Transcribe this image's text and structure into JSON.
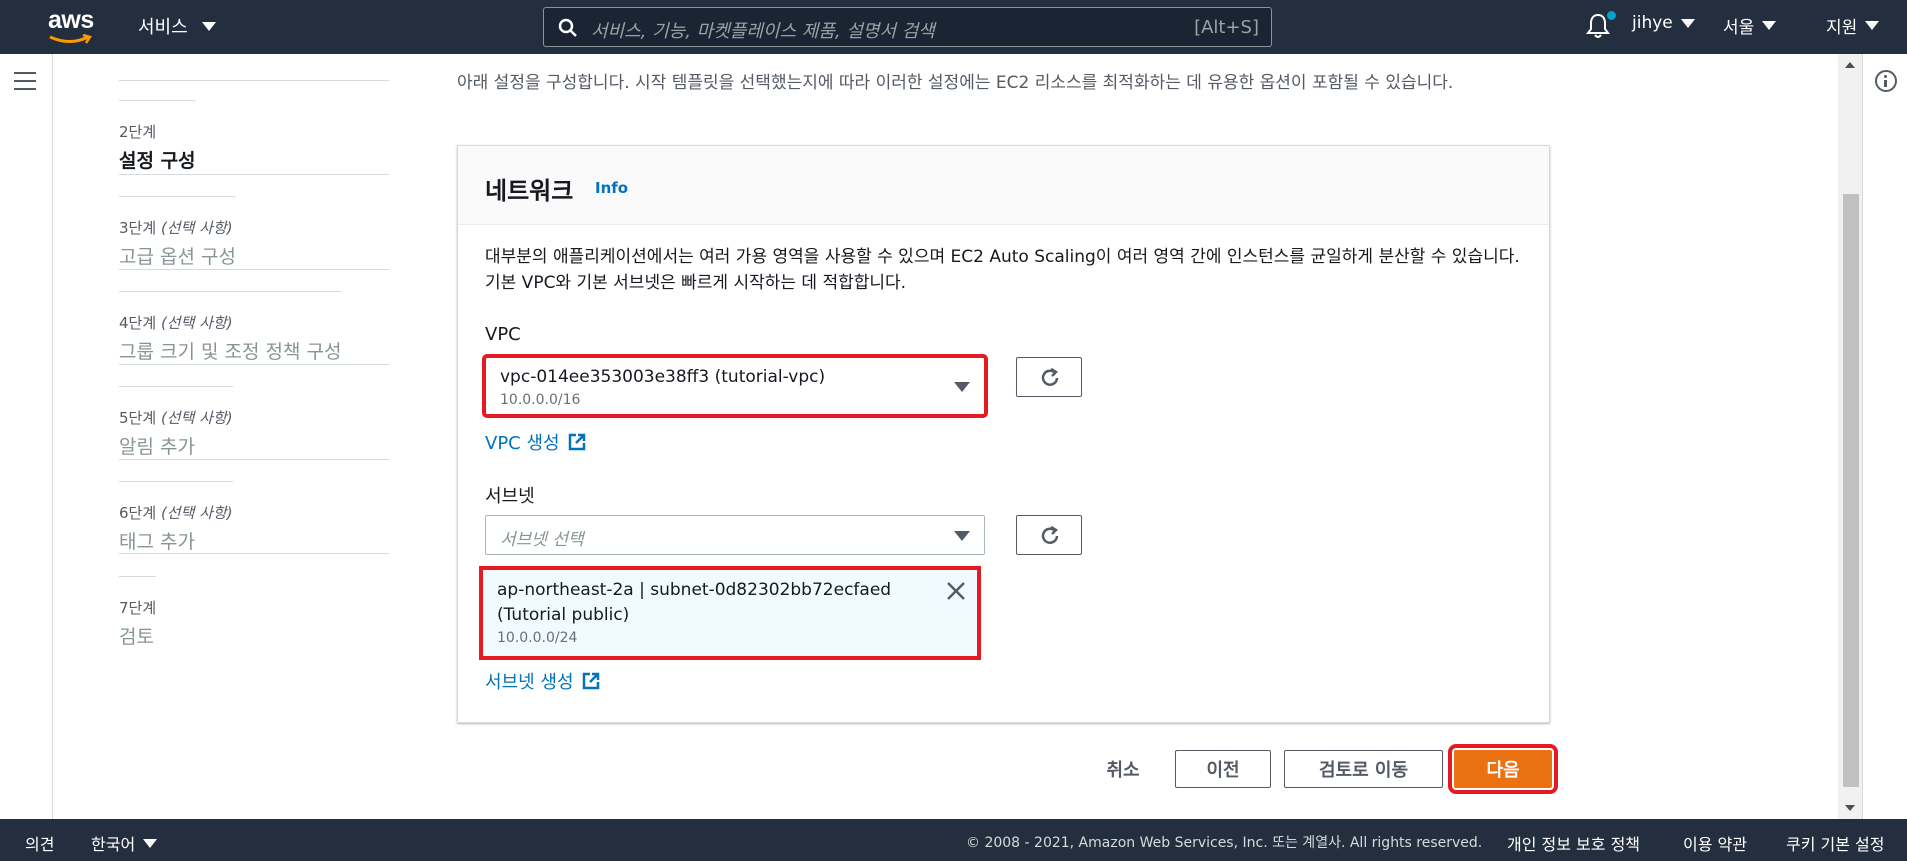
{
  "nav": {
    "logo": "aws",
    "services": "서비스",
    "search_placeholder": "서비스, 기능, 마켓플레이스 제품, 설명서 검색",
    "search_shortcut": "[Alt+S]",
    "user": "jihye",
    "region": "서울",
    "support": "지원"
  },
  "steps": [
    {
      "num": "2단계",
      "optional": "",
      "title": "설정 구성"
    },
    {
      "num": "3단계",
      "optional": "(선택 사항)",
      "title": "고급 옵션 구성"
    },
    {
      "num": "4단계",
      "optional": "(선택 사항)",
      "title": "그룹 크기 및 조정 정책 구성"
    },
    {
      "num": "5단계",
      "optional": "(선택 사항)",
      "title": "알림 추가"
    },
    {
      "num": "6단계",
      "optional": "(선택 사항)",
      "title": "태그 추가"
    },
    {
      "num": "7단계",
      "optional": "",
      "title": "검토"
    }
  ],
  "intro": "아래 설정을 구성합니다. 시작 템플릿을 선택했는지에 따라 이러한 설정에는 EC2 리소스를 최적화하는 데 유용한 옵션이 포함될 수 있습니다.",
  "network": {
    "title": "네트워크",
    "info": "Info",
    "desc": "대부분의 애플리케이션에서는 여러 가용 영역을 사용할 수 있으며 EC2 Auto Scaling이 여러 영역 간에 인스턴스를 균일하게 분산할 수 있습니다. 기본 VPC와 기본 서브넷은 빠르게 시작하는 데 적합합니다.",
    "vpc_label": "VPC",
    "vpc_value": "vpc-014ee353003e38ff3 (tutorial-vpc)",
    "vpc_cidr": "10.0.0.0/16",
    "vpc_create": "VPC 생성",
    "subnet_label": "서브넷",
    "subnet_placeholder": "서브넷 선택",
    "subnet_token_line": "ap-northeast-2a | subnet-0d82302bb72ecfaed (Tutorial public)",
    "subnet_token_cidr": "10.0.0.0/24",
    "subnet_create": "서브넷 생성"
  },
  "actions": {
    "cancel": "취소",
    "previous": "이전",
    "review": "검토로 이동",
    "next": "다음"
  },
  "footer": {
    "feedback": "의견",
    "language": "한국어",
    "copyright": "© 2008 - 2021, Amazon Web Services, Inc. 또는 계열사. All rights reserved.",
    "privacy": "개인 정보 보호 정책",
    "terms": "이용 약관",
    "cookies": "쿠키 기본 설정"
  },
  "colors": {
    "nav_bg": "#232f3e",
    "link": "#0073bb",
    "primary": "#ec7211",
    "highlight": "#e41b23"
  }
}
